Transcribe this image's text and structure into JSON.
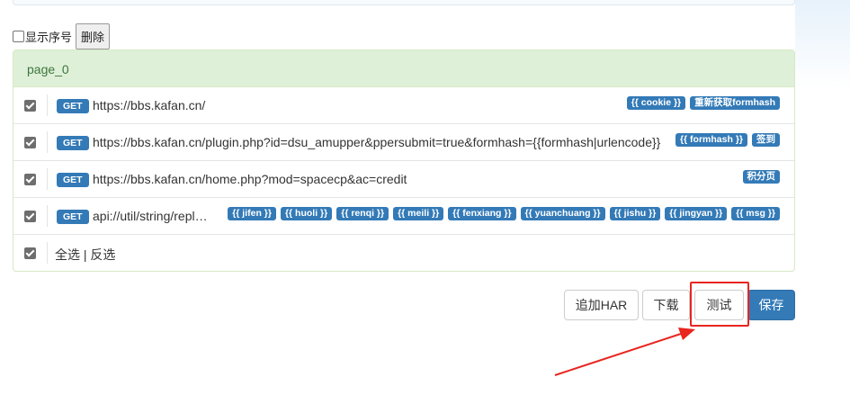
{
  "toolbar": {
    "show_index_label": "显示序号",
    "delete_label": "删除"
  },
  "panel": {
    "title": "page_0",
    "rows": [
      {
        "method": "GET",
        "url": "https://bbs.kafan.cn/",
        "tags": [
          "{{ cookie }}",
          "重新获取formhash"
        ]
      },
      {
        "method": "GET",
        "url": "https://bbs.kafan.cn/plugin.php?id=dsu_amupper&ppersubmit=true&formhash={{formhash|urlencode}}",
        "tags": [
          "{{ formhash }}",
          "签到"
        ]
      },
      {
        "method": "GET",
        "url": "https://bbs.kafan.cn/home.php?mod=spacecp&ac=credit",
        "tags": [
          "积分页"
        ]
      },
      {
        "method": "GET",
        "url": "api://util/string/replace",
        "tags": [
          "{{ jifen }}",
          "{{ huoli }}",
          "{{ renqi }}",
          "{{ meili }}",
          "{{ fenxiang }}",
          "{{ yuanchuang }}",
          "{{ jishu }}",
          "{{ jingyan }}",
          "{{ msg }}"
        ]
      }
    ],
    "select_all": "全选",
    "separator": "|",
    "invert_select": "反选"
  },
  "actions": {
    "add_har": "追加HAR",
    "download": "下载",
    "test": "测试",
    "save": "保存"
  },
  "colors": {
    "primary": "#337ab7",
    "panel_header": "#dff0d8",
    "annotation": "#e8251f"
  }
}
